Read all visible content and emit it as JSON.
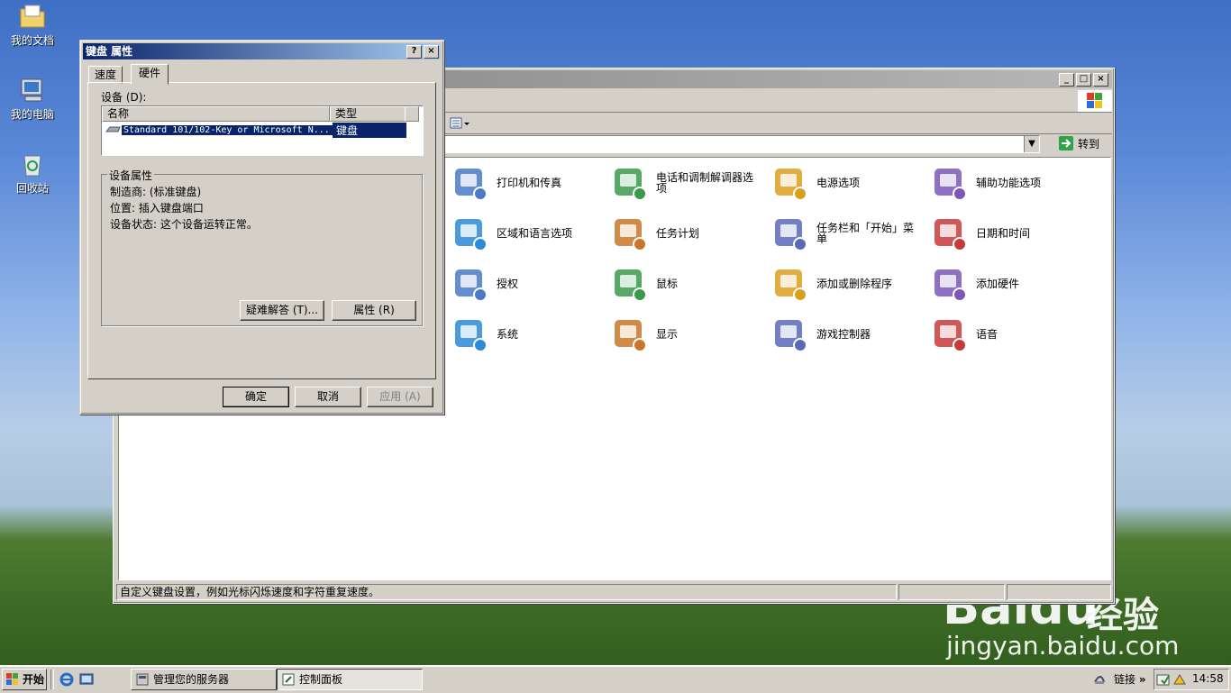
{
  "desktop": {
    "icons": [
      {
        "label": "我的文档",
        "icon": "my-documents-icon"
      },
      {
        "label": "我的电脑",
        "icon": "my-computer-icon"
      },
      {
        "label": "回收站",
        "icon": "recycle-bin-icon"
      }
    ],
    "watermark": {
      "brand": "Bai",
      "brand2": "du",
      "suffix": "经验",
      "url": "jingyan.baidu.com"
    }
  },
  "control_panel": {
    "goto_label": "转到",
    "status_text": "自定义键盘设置，例如光标闪烁速度和字符重复速度。",
    "items": [
      {
        "label": "打印机和传真",
        "icon": "printer-fax-icon"
      },
      {
        "label": "电话和调制解调器选项",
        "icon": "phone-modem-icon"
      },
      {
        "label": "电源选项",
        "icon": "power-options-icon"
      },
      {
        "label": "辅助功能选项",
        "icon": "accessibility-icon"
      },
      {
        "label": "区域和语言选项",
        "icon": "globe-icon"
      },
      {
        "label": "任务计划",
        "icon": "scheduled-tasks-icon"
      },
      {
        "label": "任务栏和「开始」菜单",
        "icon": "taskbar-start-menu-icon"
      },
      {
        "label": "日期和时间",
        "icon": "date-time-icon"
      },
      {
        "label": "授权",
        "icon": "licensing-icon"
      },
      {
        "label": "鼠标",
        "icon": "mouse-icon"
      },
      {
        "label": "添加或删除程序",
        "icon": "add-remove-programs-icon"
      },
      {
        "label": "添加硬件",
        "icon": "add-hardware-icon"
      },
      {
        "label": "系统",
        "icon": "system-icon"
      },
      {
        "label": "显示",
        "icon": "display-icon"
      },
      {
        "label": "游戏控制器",
        "icon": "game-controller-icon"
      },
      {
        "label": "语音",
        "icon": "speech-icon"
      }
    ]
  },
  "dialog": {
    "title": "键盘 属性",
    "help_btn": "?",
    "close_btn": "×",
    "tabs": [
      "速度",
      "硬件"
    ],
    "devices_label": "设备 (D):",
    "columns": [
      "名称",
      "类型"
    ],
    "device_row": {
      "name": "Standard 101/102-Key or Microsoft N...",
      "type": "键盘"
    },
    "group_title": "设备属性",
    "manufacturer": "制造商: (标准键盘)",
    "location": "位置: 插入键盘端口",
    "status": "设备状态: 这个设备运转正常。",
    "troubleshoot_btn": "疑难解答 (T)...",
    "properties_btn": "属性 (R)",
    "ok_btn": "确定",
    "cancel_btn": "取消",
    "apply_btn": "应用 (A)"
  },
  "taskbar": {
    "start_label": "开始",
    "tasks": [
      "管理您的服务器",
      "控制面板"
    ],
    "links_label": "链接",
    "chevron": "»",
    "time": "14:58"
  }
}
